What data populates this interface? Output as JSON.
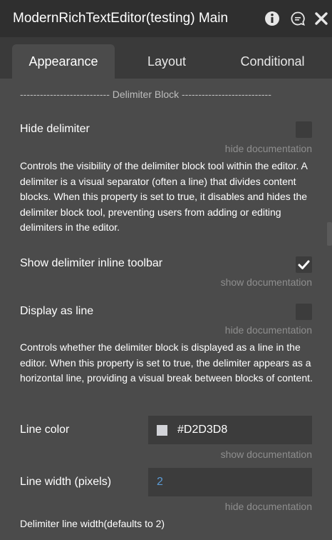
{
  "window": {
    "title": "ModernRichTextEditor(testing) Main",
    "icons": [
      "info-icon",
      "comment-icon",
      "close-icon"
    ]
  },
  "tabs": [
    {
      "label": "Appearance",
      "active": true
    },
    {
      "label": "Layout",
      "active": false
    },
    {
      "label": "Conditional",
      "active": false
    }
  ],
  "section": {
    "divider": "--------------------------- Delimiter Block ---------------------------"
  },
  "properties": {
    "hide_delimiter": {
      "label": "Hide delimiter",
      "checked": false,
      "doc_link": "hide documentation",
      "description": "Controls the visibility of the delimiter block tool within the editor. A delimiter is a visual separator (often a line) that divides content blocks. When this property is set to true, it disables and hides the delimiter block tool, preventing users from adding or editing delimiters in the editor."
    },
    "show_inline_toolbar": {
      "label": "Show delimiter inline toolbar",
      "checked": true,
      "doc_link": "show documentation"
    },
    "display_as_line": {
      "label": "Display as line",
      "checked": false,
      "doc_link": "hide documentation",
      "description": "Controls whether the delimiter block is displayed as a line in the editor. When this property is set to true, the delimiter appears as a horizontal line, providing a visual break between blocks of content."
    },
    "line_color": {
      "label": "Line color",
      "value": "#D2D3D8",
      "swatch_color": "#D2D3D8",
      "doc_link": "show documentation"
    },
    "line_width": {
      "label": "Line width (pixels)",
      "value": "2",
      "doc_link": "hide documentation",
      "description": "Delimiter line width(defaults to 2)"
    }
  },
  "colors": {
    "accent_value": "#5b9bd5",
    "panel_bg": "#4b4b4b",
    "titlebar_bg": "#2f2f2f"
  }
}
